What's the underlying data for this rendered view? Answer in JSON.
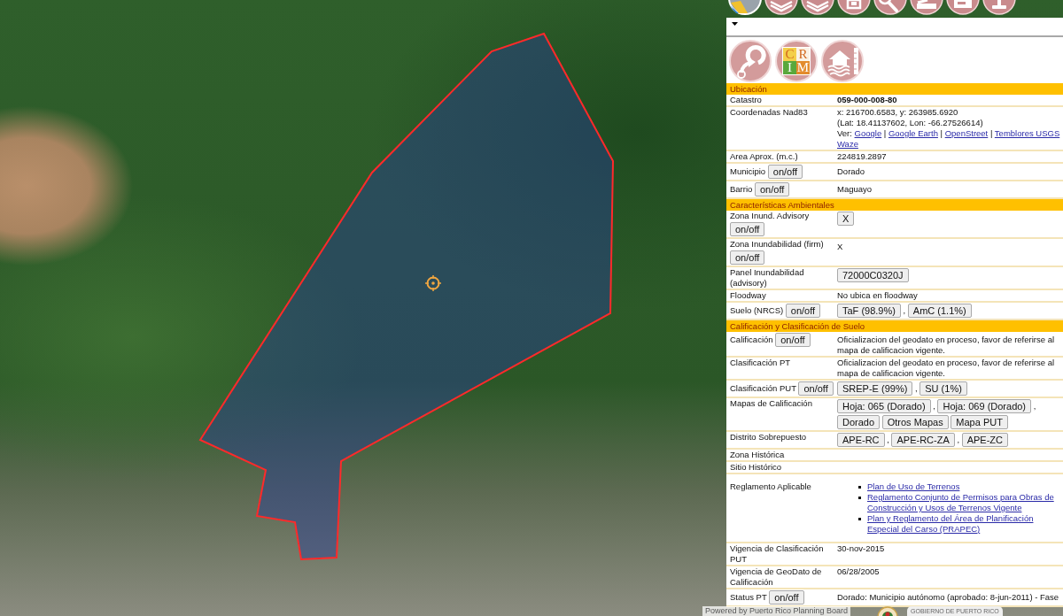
{
  "logo": {
    "letters": [
      {
        "text": "C",
        "color": "#f4cf4a"
      },
      {
        "text": "R",
        "color": "#fbf3e6"
      },
      {
        "text": "I",
        "color": "#5aa83c"
      },
      {
        "text": "M",
        "color": "#e38b2c"
      }
    ]
  },
  "sections": [
    {
      "title": "Ubicación",
      "rows": [
        {
          "label": "Catastro",
          "value": {
            "kind": "text",
            "text": "059-000-008-80",
            "bold": true
          }
        },
        {
          "label": "Coordenadas Nad83",
          "value": {
            "kind": "coords",
            "lines": [
              "x: 216700.6583, y: 263985.6920",
              "(Lat: 18.41137602, Lon: -66.27526614)"
            ],
            "link_line": [
              {
                "kind": "text",
                "text": "Ver:"
              },
              {
                "kind": "link",
                "text": "Google"
              },
              {
                "kind": "text",
                "text": "|"
              },
              {
                "kind": "link",
                "text": "Google Earth"
              },
              {
                "kind": "text",
                "text": "|"
              },
              {
                "kind": "link",
                "text": "OpenStreet"
              },
              {
                "kind": "text",
                "text": "|"
              },
              {
                "kind": "link",
                "text": "Temblores USGS"
              },
              {
                "kind": "link",
                "text": "Waze"
              }
            ]
          }
        },
        {
          "label": "Area Aprox. (m.c.)",
          "value": {
            "kind": "text",
            "text": "224819.2897"
          }
        },
        {
          "label": "Municipio",
          "toggle": "on/off",
          "value": {
            "kind": "text",
            "text": "Dorado"
          }
        },
        {
          "label": "Barrio",
          "toggle": "on/off",
          "value": {
            "kind": "text",
            "text": "Maguayo"
          }
        }
      ]
    },
    {
      "title": "Características Ambientales",
      "rows": [
        {
          "label": "Zona Inund. Advisory",
          "toggle": "on/off",
          "value": {
            "kind": "buttons",
            "items": [
              {
                "kind": "button",
                "text": "X"
              }
            ]
          }
        },
        {
          "label": "Zona Inundabilidad (firm)",
          "toggle": "on/off",
          "value": {
            "kind": "text",
            "text": "X"
          }
        },
        {
          "label": "Panel Inundabilidad (advisory)",
          "value": {
            "kind": "buttons",
            "items": [
              {
                "kind": "button",
                "text": "72000C0320J"
              }
            ]
          }
        },
        {
          "label": "Floodway",
          "value": {
            "kind": "text",
            "text": "No ubica en floodway"
          }
        },
        {
          "label": "Suelo (NRCS)",
          "toggle": "on/off",
          "value": {
            "kind": "buttons",
            "items": [
              {
                "kind": "button",
                "text": "TaF (98.9%)"
              },
              {
                "kind": "text",
                "text": ","
              },
              {
                "kind": "button",
                "text": "AmC (1.1%)"
              }
            ]
          }
        }
      ]
    },
    {
      "title": "Calificación y Clasificación de Suelo",
      "rows": [
        {
          "label": "Calificación",
          "toggle": "on/off",
          "value": {
            "kind": "text",
            "text": "Oficializacion del geodato en proceso, favor de referirse al mapa de calificacion vigente."
          }
        },
        {
          "label": "Clasificación PT",
          "value": {
            "kind": "text",
            "text": "Oficializacion del geodato en proceso, favor de referirse al mapa de calificacion vigente."
          }
        },
        {
          "label": "Clasificación PUT",
          "toggle": "on/off",
          "value": {
            "kind": "buttons",
            "items": [
              {
                "kind": "button",
                "text": "SREP-E (99%)"
              },
              {
                "kind": "text",
                "text": ","
              },
              {
                "kind": "button",
                "text": "SU (1%)"
              }
            ]
          }
        },
        {
          "label": "Mapas de Calificación",
          "value": {
            "kind": "buttons",
            "items": [
              {
                "kind": "button",
                "text": "Hoja: 065 (Dorado)"
              },
              {
                "kind": "text",
                "text": ","
              },
              {
                "kind": "button",
                "text": "Hoja: 069 (Dorado)"
              },
              {
                "kind": "text",
                "text": ","
              },
              {
                "kind": "button",
                "text": "Dorado"
              },
              {
                "kind": "button",
                "text": "Otros Mapas"
              },
              {
                "kind": "button",
                "text": "Mapa PUT"
              }
            ]
          }
        },
        {
          "label": "Distrito Sobrepuesto",
          "value": {
            "kind": "buttons",
            "items": [
              {
                "kind": "button",
                "text": "APE-RC"
              },
              {
                "kind": "text",
                "text": ","
              },
              {
                "kind": "button",
                "text": "APE-RC-ZA"
              },
              {
                "kind": "text",
                "text": ","
              },
              {
                "kind": "button",
                "text": "APE-ZC"
              }
            ]
          }
        },
        {
          "label": "Zona Histórica"
        },
        {
          "label": "Sitio Histórico"
        },
        {
          "label": "Reglamento Aplicable",
          "value": {
            "kind": "links",
            "items": [
              "Plan de Uso de Terrenos",
              "Reglamento Conjunto de Permisos para Obras de Construcción y Usos de Terrenos Vigente",
              "Plan y Reglamento del Área de Planificación Especial del Carso (PRAPEC)"
            ]
          }
        },
        {
          "label": "Vigencia de Clasificación PUT",
          "value": {
            "kind": "text",
            "text": "30-nov-2015"
          }
        },
        {
          "label": "Vigencia de GeoDato de Calificación",
          "value": {
            "kind": "text",
            "text": "06/28/2005"
          }
        },
        {
          "label": "Status PT",
          "toggle": "on/off",
          "value": {
            "kind": "text",
            "text": "Dorado: Municipio autónomo (aprobado: 8-jun-2011) - Fase"
          }
        }
      ]
    }
  ],
  "attribution": "Powered by Puerto Rico Planning Board",
  "government_logo": {
    "text": "GOBIERNO DE PUERTO RICO"
  }
}
